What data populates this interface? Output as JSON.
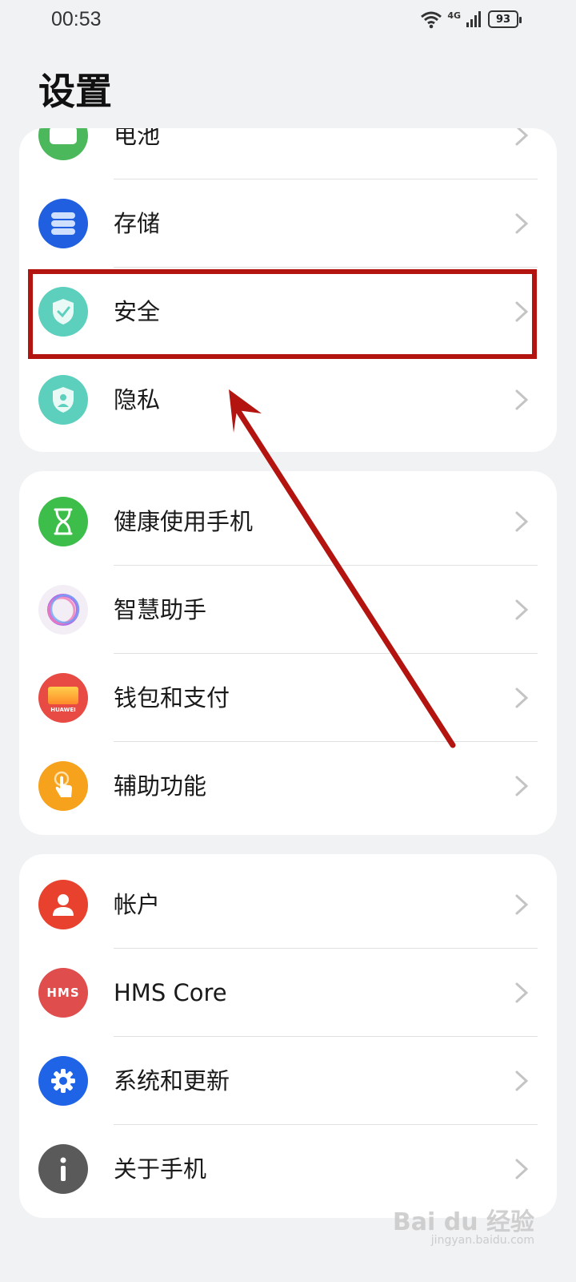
{
  "status_bar": {
    "time": "00:53",
    "network": "4G",
    "battery": "93"
  },
  "page": {
    "title": "设置"
  },
  "group1": {
    "items": [
      {
        "label": "电池",
        "icon": "battery-icon",
        "color": "#4cb85c"
      },
      {
        "label": "存储",
        "icon": "storage-icon",
        "color": "#1f5fe0"
      },
      {
        "label": "安全",
        "icon": "security-shield-icon",
        "color": "#5ccfbd"
      },
      {
        "label": "隐私",
        "icon": "privacy-shield-icon",
        "color": "#5ccfbd"
      }
    ]
  },
  "group2": {
    "items": [
      {
        "label": "健康使用手机",
        "icon": "hourglass-icon",
        "color": "#3dbd4a"
      },
      {
        "label": "智慧助手",
        "icon": "assistant-ring-icon",
        "color": "#f3eef6"
      },
      {
        "label": "钱包和支付",
        "icon": "wallet-icon",
        "color": "#e84a44"
      },
      {
        "label": "辅助功能",
        "icon": "accessibility-hand-icon",
        "color": "#f6a21c"
      }
    ]
  },
  "group3": {
    "items": [
      {
        "label": "帐户",
        "icon": "account-icon",
        "color": "#e8422f"
      },
      {
        "label": "HMS Core",
        "icon": "hms-core-icon",
        "color": "#df4d4d"
      },
      {
        "label": "系统和更新",
        "icon": "gear-icon",
        "color": "#1f63e6"
      },
      {
        "label": "关于手机",
        "icon": "info-icon",
        "color": "#5a5a5a"
      }
    ]
  },
  "hms_badge": "HMS",
  "wallet_brand": "HUAWEI",
  "annotation": {
    "highlight_color": "#b3140f"
  },
  "watermark": {
    "text": "Bai du 经验",
    "sub": "jingyan.baidu.com"
  }
}
